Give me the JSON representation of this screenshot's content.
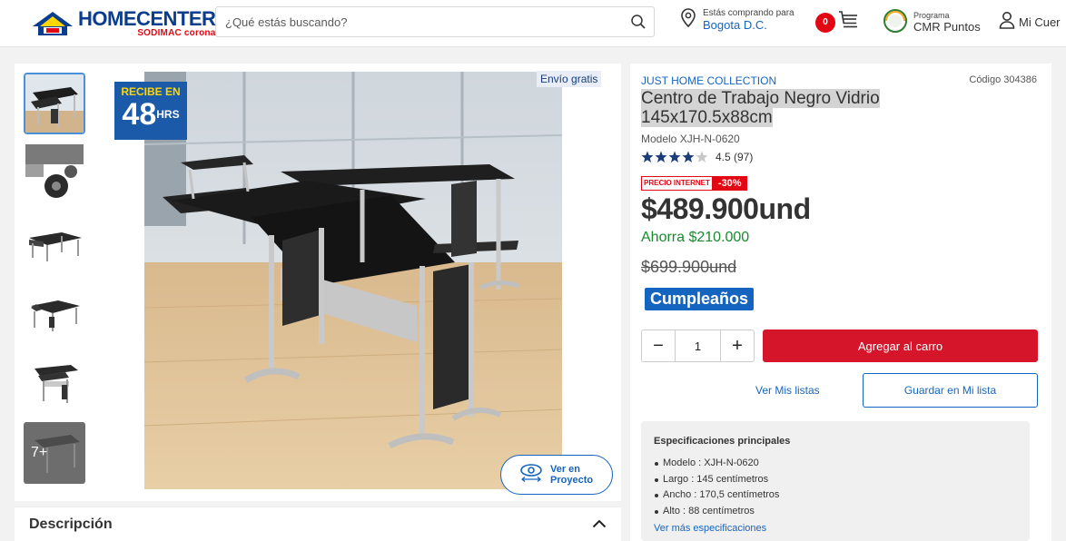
{
  "header": {
    "logo_main": "HOMECENTER",
    "logo_sub": "SODIMAC corona",
    "search_placeholder": "¿Qué estás buscando?",
    "location_line1": "Estás comprando para",
    "location_line2": "Bogota D.C.",
    "cart_count": "0",
    "cmr_line1": "Programa",
    "cmr_line2": "CMR Puntos",
    "account_label": "Mi Cuer"
  },
  "gallery": {
    "badge_recibe": "RECIBE EN",
    "badge_hours": "48",
    "badge_hrs": "HRS",
    "free_shipping": "Envío gratis",
    "more_count": "7+",
    "ver_proyecto_1": "Ver en",
    "ver_proyecto_2": "Proyecto"
  },
  "description": {
    "title": "Descripción"
  },
  "product": {
    "brand": "JUST HOME COLLECTION",
    "code": "Código 304386",
    "title_line1": "Centro de Trabajo Negro Vidrio",
    "title_line2": "145x170.5x88cm",
    "model": "Modelo XJH-N-0620",
    "rating": 4.5,
    "rating_text": "4.5 (97)",
    "price_internet_label": "PRECIO INTERNET",
    "discount": "-30%",
    "price": "$489.900und",
    "savings": "Ahorra $210.000",
    "old_price": "$699.900und",
    "promo_badge": "Cumpleaños",
    "quantity": "1",
    "qty_minus": "−",
    "qty_plus": "+",
    "add_to_cart": "Agregar al carro",
    "view_lists": "Ver Mis listas",
    "save_to_list": "Guardar en Mi lista"
  },
  "specs": {
    "heading": "Especificaciones principales",
    "items": [
      "Modelo : XJH-N-0620",
      "Largo : 145 centímetros",
      "Ancho : 170,5 centímetros",
      "Alto : 88 centímetros"
    ],
    "more_link": "Ver más especificaciones"
  },
  "colors": {
    "brand_blue": "#1565c0",
    "cart_red": "#d5152a",
    "discount_red": "#e30613",
    "savings_green": "#1a8a2e"
  }
}
